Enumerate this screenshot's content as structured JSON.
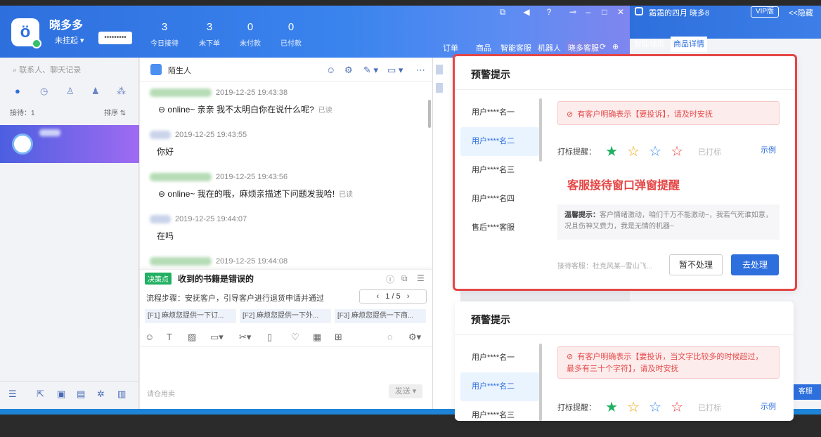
{
  "app": {
    "brand": "晓多多",
    "status": "未挂起",
    "password": "•••••••••"
  },
  "stats": [
    {
      "value": "3",
      "label": "今日接待"
    },
    {
      "value": "3",
      "label": "未下单"
    },
    {
      "value": "0",
      "label": "未付款"
    },
    {
      "value": "0",
      "label": "已付款"
    }
  ],
  "nav": [
    "订单",
    "商品",
    "智能客服",
    "机器人",
    "晓多客服"
  ],
  "side": {
    "title": "霜霜的四月 晓多8",
    "vip": "VIP版",
    "hide": "<<隐藏",
    "tabs": [
      "智能辅助",
      "商品详情"
    ],
    "cs_tag": "客服"
  },
  "left": {
    "search_placeholder": "联系人、聊天记录",
    "receiving": "接待：1",
    "sort": "排序 ⇅"
  },
  "chat": {
    "contact_name": "陌生人",
    "messages": [
      {
        "time": "2019-12-25 19:43:38",
        "text": "online~ 亲亲 我不太明白你在说什么呢?",
        "read": "已读"
      },
      {
        "time": "2019-12-25 19:43:55",
        "text": "你好"
      },
      {
        "time": "2019-12-25 19:43:56",
        "text": "online~ 我在的哦，麻烦亲描述下问题发我哈!",
        "read": "已读"
      },
      {
        "time": "2019-12-25 19:44:07",
        "text": "在吗"
      },
      {
        "time": "2019-12-25 19:44:08",
        "text": ""
      }
    ],
    "decision": {
      "tag": "决策点",
      "title": "收到的书籍是错误的",
      "steps": "流程步骤：安抚客户，引导客户进行退货申请并通过",
      "pager": "1 / 5",
      "f1": "[F1] 麻烦您提供一下订...",
      "f2": "[F2] 麻烦您提供一下外...",
      "f3": "[F3] 麻烦您提供一下商..."
    },
    "input_placeholder": "请仓用卖",
    "send": "发送 ▾"
  },
  "card1": {
    "title": "预警提示",
    "users": [
      "用户****名一",
      "用户****名二",
      "用户****名三",
      "用户****名四",
      "售后****客服"
    ],
    "alert": "有客户明确表示【要投诉】，请及时安抚",
    "star_label": "打标提醒：",
    "stars_done": "已打标",
    "example": "示例",
    "red_title": "客服接待窗口弹窗提醒",
    "tip_label": "温馨提示：",
    "tip": "客户情绪激动，咱们千万不能激动~，我若气死谁如意，况且伤神又费力，我是无情的机器~",
    "agent": "接待客服：杜克风某--雪山飞...",
    "btn_ignore": "暂不处理",
    "btn_handle": "去处理"
  },
  "card2": {
    "title": "预警提示",
    "users": [
      "用户****名一",
      "用户****名二",
      "用户****名三"
    ],
    "alert": "有客户明确表示【要投诉，当文字比较多的时候超过，最多有三十个字符】，请及时安抚",
    "star_label": "打标提醒：",
    "stars_done": "已打标",
    "example": "示例"
  },
  "colors": {
    "accent": "#2e6fde",
    "alert": "#e54545",
    "green": "#21b061"
  }
}
